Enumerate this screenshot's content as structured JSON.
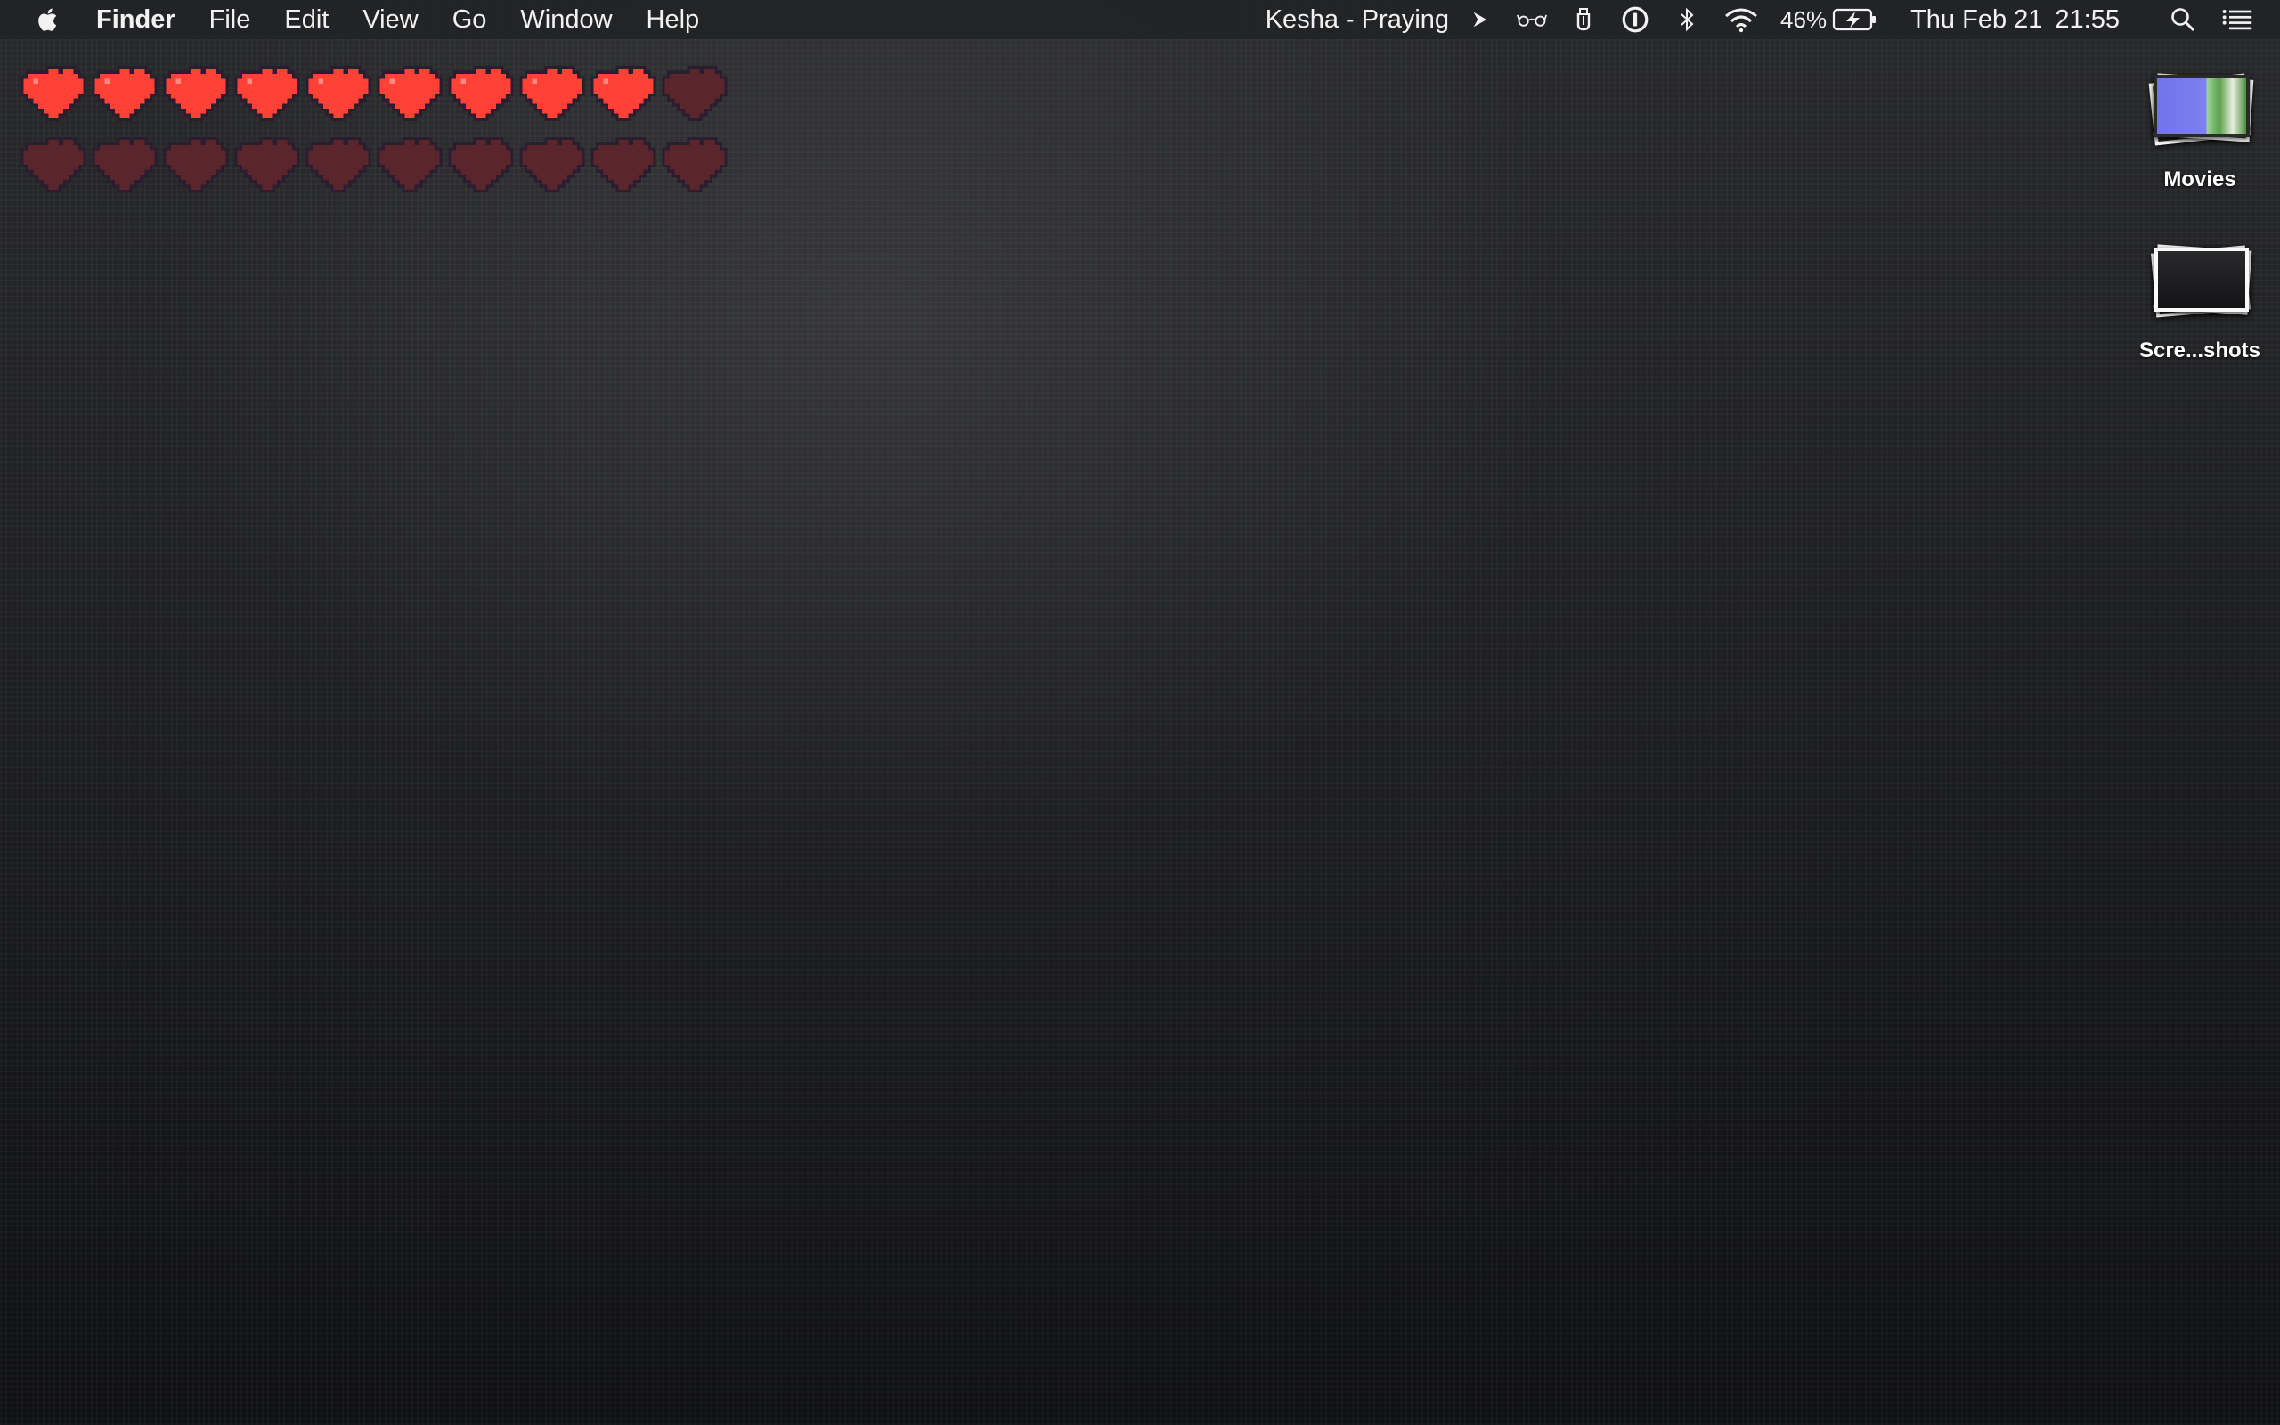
{
  "menubar": {
    "app_name": "Finder",
    "menus": [
      "File",
      "Edit",
      "View",
      "Go",
      "Window",
      "Help"
    ],
    "now_playing": "Kesha - Praying",
    "battery_percent": "46%",
    "date": "Thu Feb 21",
    "time": "21:55",
    "status_icons": [
      "airplay-icon",
      "glasses-icon",
      "clipboard-icon",
      "1password-icon",
      "bluetooth-icon",
      "wifi-icon",
      "battery-charging-icon",
      "spotlight-search-icon",
      "notification-center-icon"
    ]
  },
  "hearts_widget": {
    "total": 20,
    "filled": 9,
    "filled_color": "#ff4136",
    "empty_color": "#5a262b"
  },
  "desktop": {
    "icons": [
      {
        "label": "Movies",
        "icon": "movies-stack-icon"
      },
      {
        "label": "Scre...shots",
        "icon": "screenshots-stack-icon"
      }
    ]
  }
}
